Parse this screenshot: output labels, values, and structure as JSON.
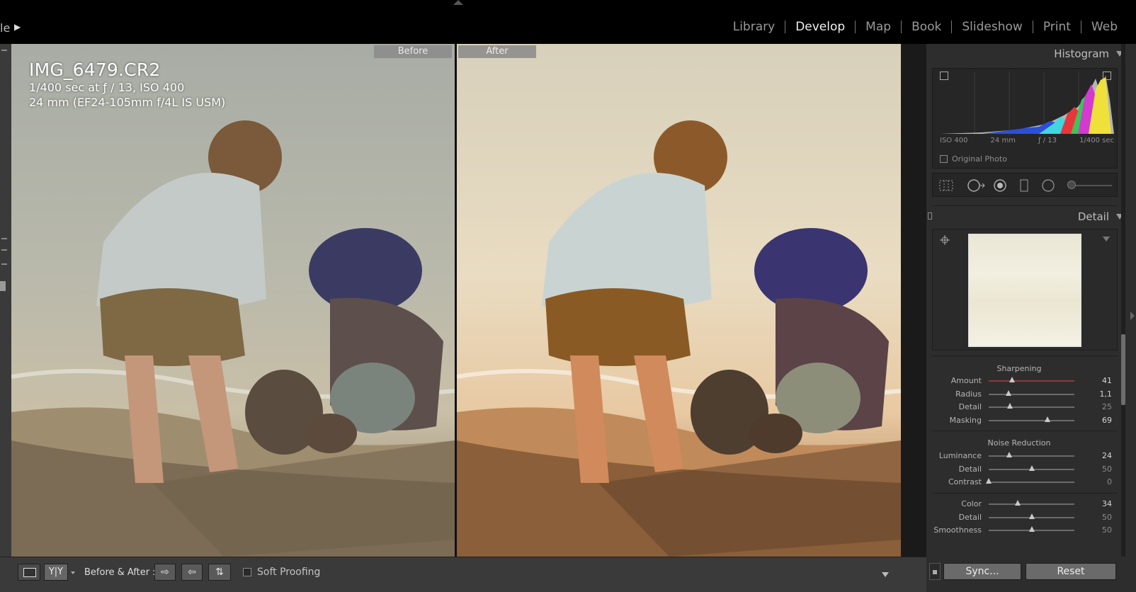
{
  "header": {
    "identity_text": "le",
    "modules": [
      {
        "label": "Library",
        "active": false
      },
      {
        "label": "Develop",
        "active": true
      },
      {
        "label": "Map",
        "active": false
      },
      {
        "label": "Book",
        "active": false
      },
      {
        "label": "Slideshow",
        "active": false
      },
      {
        "label": "Print",
        "active": false
      },
      {
        "label": "Web",
        "active": false
      }
    ]
  },
  "photo": {
    "filename": "IMG_6479.CR2",
    "exposure": "1/400 sec at ƒ / 13, ISO 400",
    "lens": "24 mm (EF24-105mm f/4L IS USM)",
    "before_label": "Before",
    "after_label": "After"
  },
  "histogram": {
    "title": "Histogram",
    "iso": "ISO 400",
    "focal": "24 mm",
    "aperture": "ƒ / 13",
    "shutter": "1/400 sec",
    "original_photo_label": "Original Photo",
    "colors": {
      "red": "#e8373b",
      "green": "#3fc25a",
      "blue": "#2c4fd8",
      "yellow": "#f0e13a",
      "magenta": "#d23ad0",
      "cyan": "#3fd7e0",
      "gray": "#b5b5b5"
    }
  },
  "detail": {
    "title": "Detail",
    "sharpening": {
      "title": "Sharpening",
      "sliders": [
        {
          "label": "Amount",
          "value": "41",
          "fraction": 0.27,
          "dim": false,
          "red": true
        },
        {
          "label": "Radius",
          "value": "1,1",
          "fraction": 0.23,
          "dim": false,
          "red": false
        },
        {
          "label": "Detail",
          "value": "25",
          "fraction": 0.25,
          "dim": true,
          "red": false
        },
        {
          "label": "Masking",
          "value": "69",
          "fraction": 0.69,
          "dim": false,
          "red": false
        }
      ]
    },
    "noise_reduction": {
      "title": "Noise Reduction",
      "sliders": [
        {
          "label": "Luminance",
          "value": "24",
          "fraction": 0.24,
          "dim": false,
          "red": false
        },
        {
          "label": "Detail",
          "value": "50",
          "fraction": 0.5,
          "dim": true,
          "red": false
        },
        {
          "label": "Contrast",
          "value": "0",
          "fraction": 0.0,
          "dim": true,
          "red": false
        }
      ],
      "color_sliders": [
        {
          "label": "Color",
          "value": "34",
          "fraction": 0.34,
          "dim": false,
          "red": false
        },
        {
          "label": "Detail",
          "value": "50",
          "fraction": 0.5,
          "dim": true,
          "red": false
        },
        {
          "label": "Smoothness",
          "value": "50",
          "fraction": 0.5,
          "dim": true,
          "red": false
        }
      ]
    }
  },
  "toolbar": {
    "yy_label": "Y|Y",
    "before_after_label": "Before & After :",
    "soft_proofing_label": "Soft Proofing"
  },
  "right_toolbar": {
    "sync_label": "Sync...",
    "reset_label": "Reset"
  }
}
